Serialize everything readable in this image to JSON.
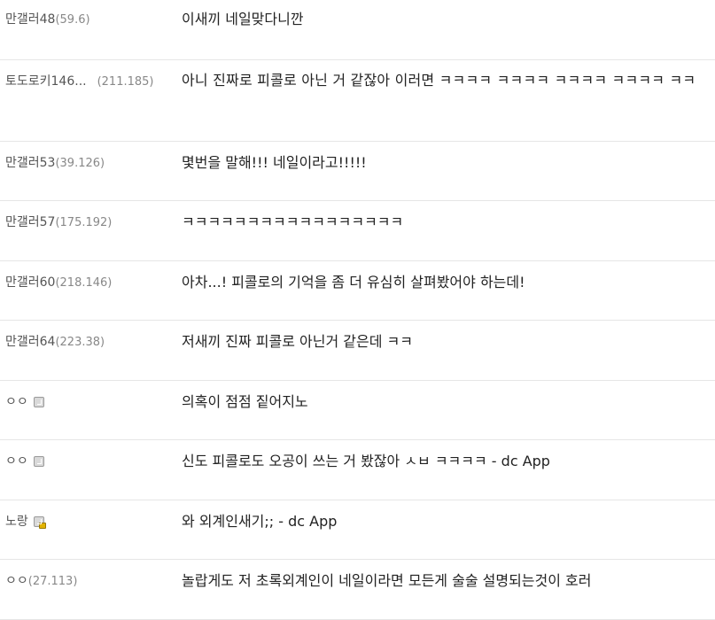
{
  "comments": [
    {
      "nick": "만갤러48",
      "ip": "(59.6)",
      "text": "이새끼 네일맞다니깐"
    },
    {
      "nick": "토도로키146...",
      "ip": "(211.185)",
      "text": "아니 진짜로 피콜로 아닌 거 같잖아 이러면 ㅋㅋㅋㅋ ㅋㅋㅋㅋ ㅋㅋㅋㅋ ㅋㅋㅋㅋ ㅋㅋ"
    },
    {
      "nick": "만갤러53",
      "ip": "(39.126)",
      "text": "몇번을 말해!!! 네일이라고!!!!!"
    },
    {
      "nick": "만갤러57",
      "ip": "(175.192)",
      "text": "ㅋㅋㅋㅋㅋㅋㅋㅋㅋㅋㅋㅋㅋㅋㅋㅋㅋ"
    },
    {
      "nick": "만갤러60",
      "ip": "(218.146)",
      "text": "아차...! 피콜로의 기억을 좀 더 유심히 살펴봤어야 하는데!"
    },
    {
      "nick": "만갤러64",
      "ip": "(223.38)",
      "text": "저새끼 진짜 피콜로 아닌거 같은데 ㅋㅋ"
    },
    {
      "nick": "ㅇㅇ",
      "ip": "",
      "badge": "fixed-nick-icon",
      "text": "의혹이 점점 짙어지노"
    },
    {
      "nick": "ㅇㅇ",
      "ip": "",
      "badge": "fixed-nick-icon",
      "text": "신도 피콜로도 오공이 쓰는 거 봤잖아 ㅅㅂ ㅋㅋㅋㅋ - dc App"
    },
    {
      "nick": "노랑",
      "ip": "",
      "badge": "fixed-nick-lock-icon",
      "text": "와 외계인새기;; - dc App"
    },
    {
      "nick": "ㅇㅇ",
      "ip": "(27.113)",
      "text": "놀랍게도 저 초록외계인이 네일이라면 모든게 술술 설명되는것이 호러"
    }
  ]
}
